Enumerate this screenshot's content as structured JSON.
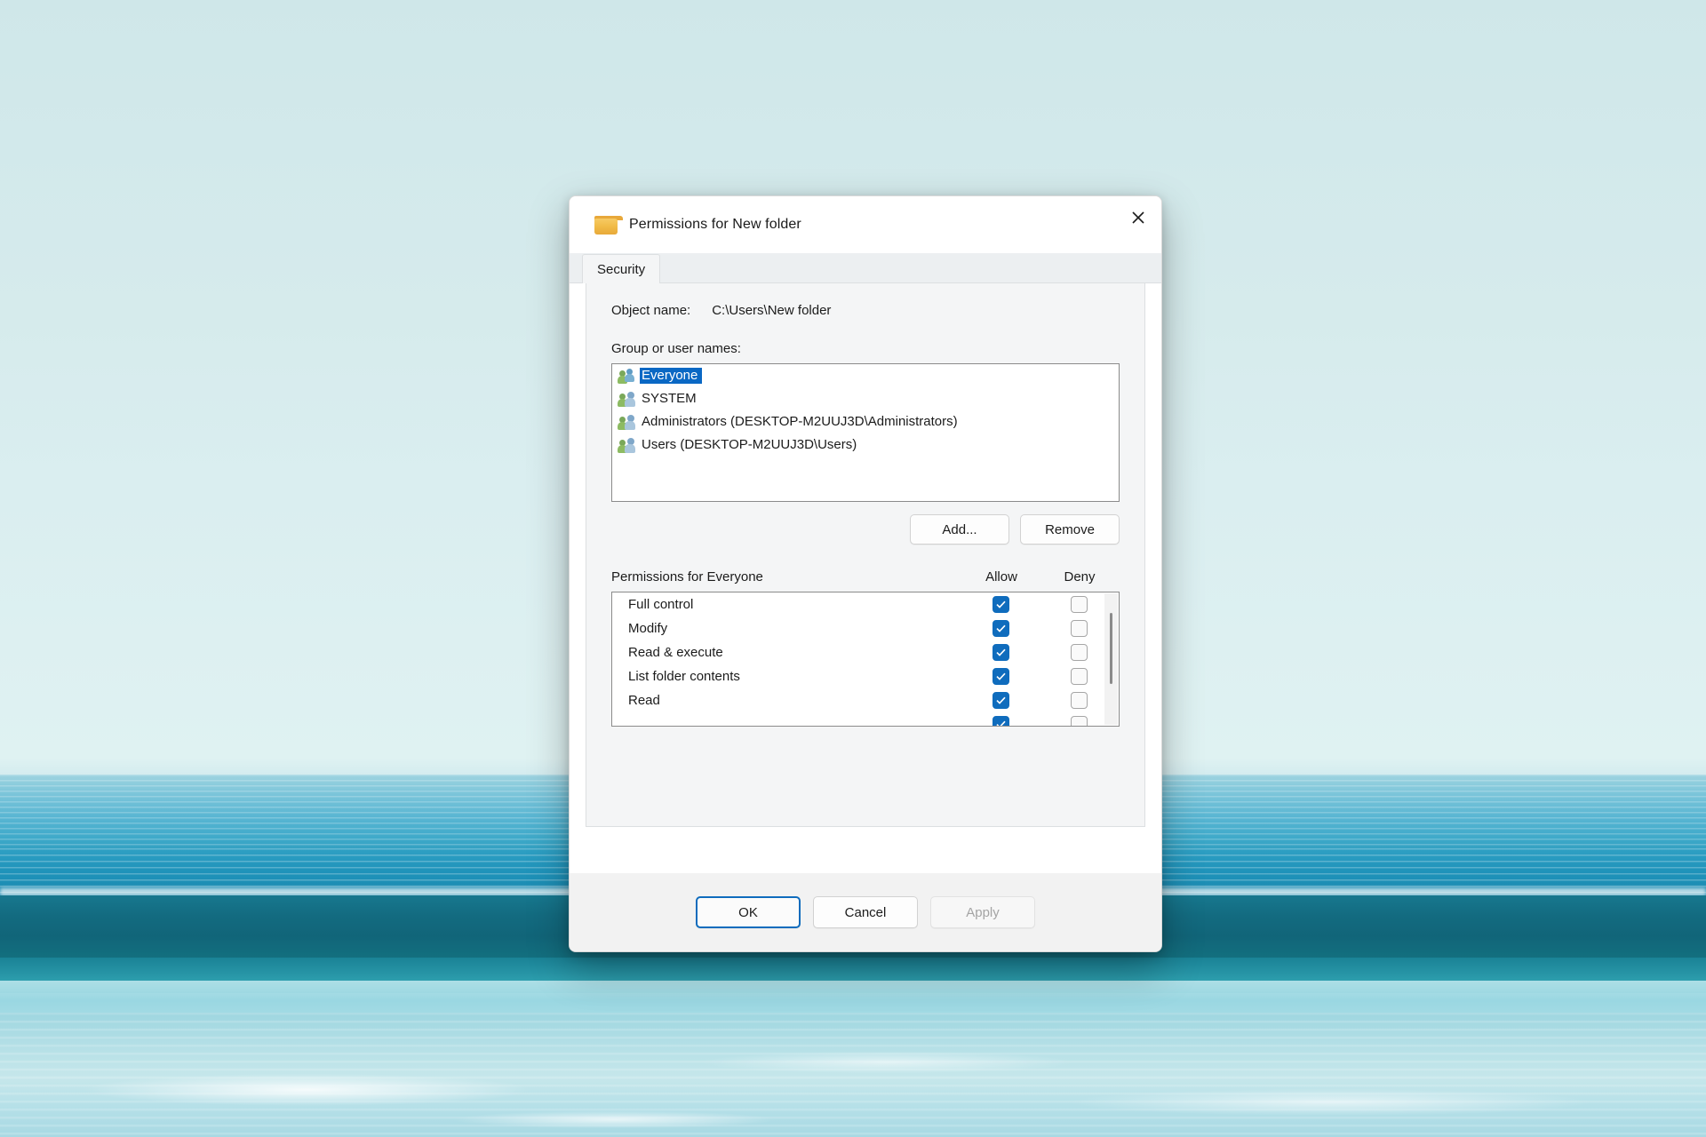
{
  "wallpaper": {
    "description": "ocean-wave-photo"
  },
  "dialog": {
    "title": "Permissions for New folder",
    "folder_icon": "folder-icon",
    "close_icon": "close-icon",
    "tabs": [
      {
        "label": "Security",
        "active": true
      }
    ],
    "object_name_label": "Object name:",
    "object_name_value": "C:\\Users\\New folder",
    "group_label": "Group or user names:",
    "group_list": [
      {
        "name": "Everyone",
        "icon": "users-icon",
        "selected": true
      },
      {
        "name": "SYSTEM",
        "icon": "users-icon",
        "selected": false
      },
      {
        "name": "Administrators (DESKTOP-M2UUJ3D\\Administrators)",
        "icon": "users-icon",
        "selected": false
      },
      {
        "name": "Users (DESKTOP-M2UUJ3D\\Users)",
        "icon": "users-icon",
        "selected": false
      }
    ],
    "add_label": "Add...",
    "remove_label": "Remove",
    "permissions_header": "Permissions for Everyone",
    "allow_col": "Allow",
    "deny_col": "Deny",
    "permissions": [
      {
        "name": "Full control",
        "allow": true,
        "deny": false
      },
      {
        "name": "Modify",
        "allow": true,
        "deny": false
      },
      {
        "name": "Read & execute",
        "allow": true,
        "deny": false
      },
      {
        "name": "List folder contents",
        "allow": true,
        "deny": false
      },
      {
        "name": "Read",
        "allow": true,
        "deny": false
      },
      {
        "name": "",
        "allow": true,
        "deny": false
      }
    ],
    "ok_label": "OK",
    "cancel_label": "Cancel",
    "apply_label": "Apply",
    "apply_enabled": false,
    "colors": {
      "accent": "#0f6cbd",
      "selection": "#0a68c4",
      "dialog_bg": "#ffffff",
      "panel_bg": "#f4f5f6",
      "footer_bg": "#f2f2f2"
    }
  }
}
